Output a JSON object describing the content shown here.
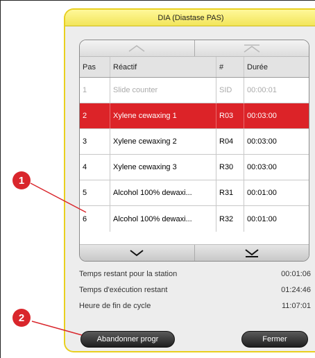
{
  "dialog": {
    "title": "DIA (Diastase PAS)"
  },
  "table": {
    "headers": {
      "step": "Pas",
      "reagent": "Réactif",
      "number": "#",
      "duration": "Durée"
    },
    "rows": [
      {
        "step": "1",
        "reagent": "Slide counter",
        "number": "SID",
        "duration": "00:00:01",
        "state": "disabled"
      },
      {
        "step": "2",
        "reagent": "Xylene cewaxing 1",
        "number": "R03",
        "duration": "00:03:00",
        "state": "selected"
      },
      {
        "step": "3",
        "reagent": "Xylene cewaxing 2",
        "number": "R04",
        "duration": "00:03:00",
        "state": "normal"
      },
      {
        "step": "4",
        "reagent": "Xylene cewaxing 3",
        "number": "R30",
        "duration": "00:03:00",
        "state": "normal"
      },
      {
        "step": "5",
        "reagent": "Alcohol 100% dewaxi...",
        "number": "R31",
        "duration": "00:01:00",
        "state": "normal"
      },
      {
        "step": "6",
        "reagent": "Alcohol 100% dewaxi...",
        "number": "R32",
        "duration": "00:01:00",
        "state": "normal"
      }
    ]
  },
  "info": {
    "station_label": "Temps restant pour la station",
    "station_value": "00:01:06",
    "run_label": "Temps d'exécution restant",
    "run_value": "01:24:46",
    "end_label": "Heure de fin de cycle",
    "end_value": "11:07:01"
  },
  "buttons": {
    "abort_label": "Abandonner progr",
    "close_label": "Fermer"
  },
  "callouts": {
    "one": "1",
    "two": "2"
  },
  "colors": {
    "title_bar": "#f2e55a",
    "selected_row": "#dc2328",
    "callout": "#d9262c"
  },
  "icons": {
    "scroll_up": "chevron-up-icon",
    "scroll_top": "chevron-top-icon",
    "scroll_down": "chevron-down-icon",
    "scroll_bottom": "chevron-bottom-icon"
  }
}
